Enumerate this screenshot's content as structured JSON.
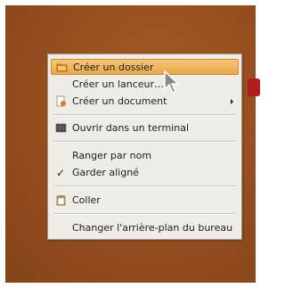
{
  "menu": {
    "create_folder": "Créer un dossier",
    "create_launcher": "Créer un lanceur…",
    "create_document": "Créer un document",
    "open_terminal": "Ouvrir dans un terminal",
    "sort_by_name": "Ranger par nom",
    "keep_aligned": "Garder aligné",
    "keep_aligned_check": "✓",
    "paste": "Coller",
    "change_background": "Changer l'arrière-plan du bureau"
  },
  "icons": {
    "create_folder": "folder-icon",
    "create_document": "document-icon",
    "open_terminal": "terminal-icon",
    "paste": "clipboard-icon",
    "submenu": "chevron-right-icon",
    "cursor": "mouse-pointer-icon"
  },
  "colors": {
    "desktop": "#98501f",
    "menu_bg": "#efebe7",
    "highlight": "#efb25e"
  }
}
